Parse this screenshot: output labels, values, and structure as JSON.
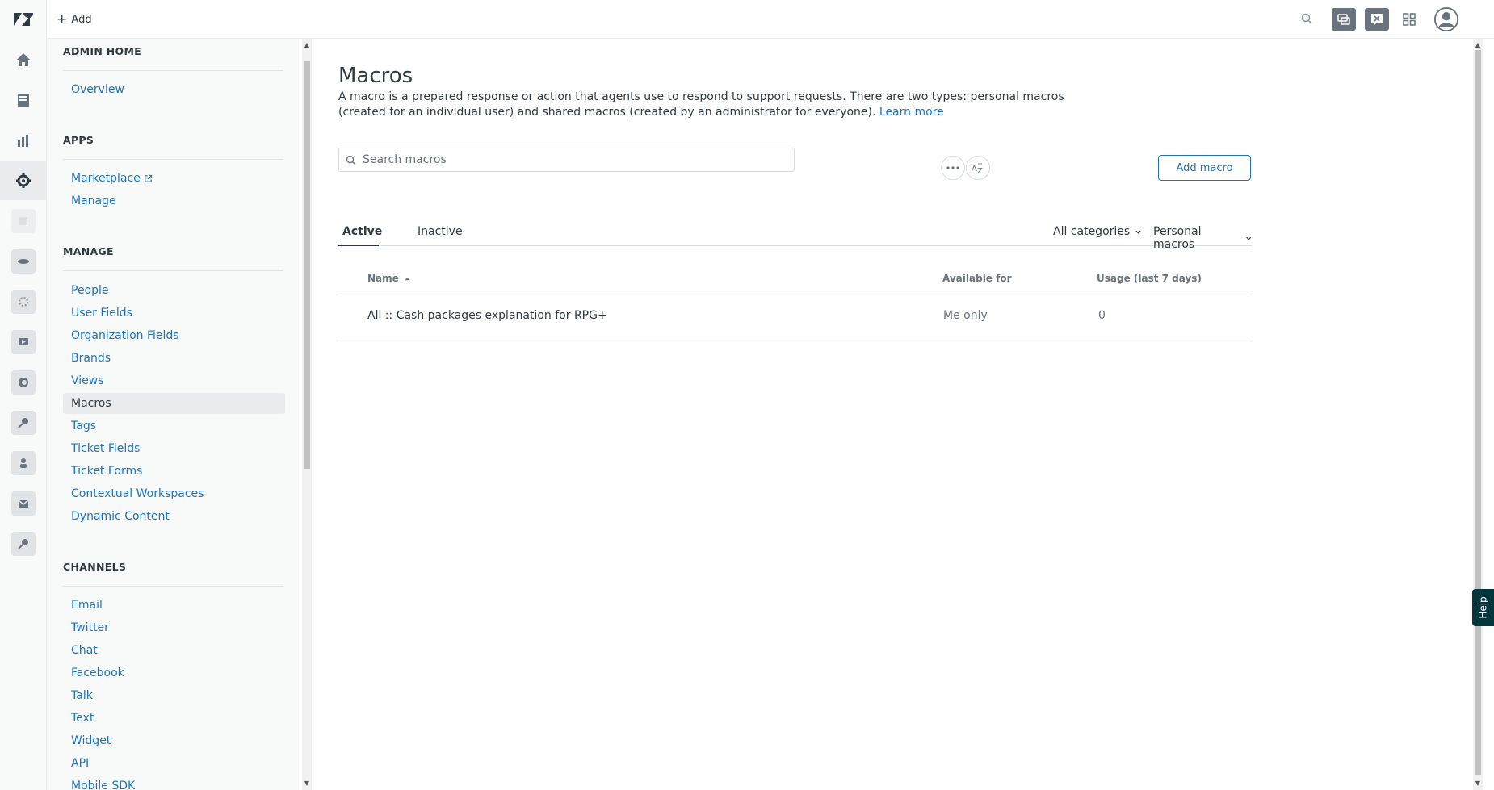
{
  "topbar": {
    "add_label": "Add",
    "icons": [
      "search-icon",
      "conversations-icon",
      "product-tray-icon",
      "apps-grid-icon",
      "user-avatar-icon"
    ]
  },
  "rail": {
    "items": [
      "home-icon",
      "views-icon",
      "reporting-icon",
      "admin-gear-icon",
      "app-icon",
      "app-icon",
      "app-icon",
      "app-icon",
      "app-icon",
      "app-icon",
      "app-icon",
      "app-icon",
      "app-icon"
    ]
  },
  "sidebar": {
    "sections": [
      {
        "title": "ADMIN HOME",
        "items": [
          {
            "label": "Overview"
          }
        ]
      },
      {
        "title": "APPS",
        "items": [
          {
            "label": "Marketplace"
          },
          {
            "label": "Manage"
          }
        ]
      },
      {
        "title": "MANAGE",
        "items": [
          {
            "label": "People"
          },
          {
            "label": "User Fields"
          },
          {
            "label": "Organization Fields"
          },
          {
            "label": "Brands"
          },
          {
            "label": "Views"
          },
          {
            "label": "Macros"
          },
          {
            "label": "Tags"
          },
          {
            "label": "Ticket Fields"
          },
          {
            "label": "Ticket Forms"
          },
          {
            "label": "Contextual Workspaces"
          },
          {
            "label": "Dynamic Content"
          }
        ]
      },
      {
        "title": "CHANNELS",
        "items": [
          {
            "label": "Email"
          },
          {
            "label": "Twitter"
          },
          {
            "label": "Chat"
          },
          {
            "label": "Facebook"
          },
          {
            "label": "Talk"
          },
          {
            "label": "Text"
          },
          {
            "label": "Widget"
          },
          {
            "label": "API"
          },
          {
            "label": "Mobile SDK"
          }
        ]
      }
    ],
    "active_item": "Macros"
  },
  "main": {
    "title": "Macros",
    "description": "A macro is a prepared response or action that agents use to respond to support requests. There are two types: personal macros (created for an individual user) and shared macros (created by an administrator for everyone).",
    "learn_more": "Learn more",
    "search_placeholder": "Search macros",
    "add_macro_label": "Add macro",
    "tabs": [
      {
        "label": "Active"
      },
      {
        "label": "Inactive"
      }
    ],
    "active_tab": "Active",
    "category_filter": "All categories",
    "type_filter": "Personal macros",
    "columns": [
      "Name",
      "Available for",
      "Usage (last 7 days)"
    ],
    "rows": [
      {
        "name": "All :: Cash packages explanation for RPG+",
        "available_for": "Me only",
        "usage": "0"
      }
    ]
  },
  "help_label": "Help",
  "colors": {
    "accent": "#1f73b7",
    "text": "#2f3941",
    "muted": "#68737d",
    "help_bg": "#03363d"
  }
}
